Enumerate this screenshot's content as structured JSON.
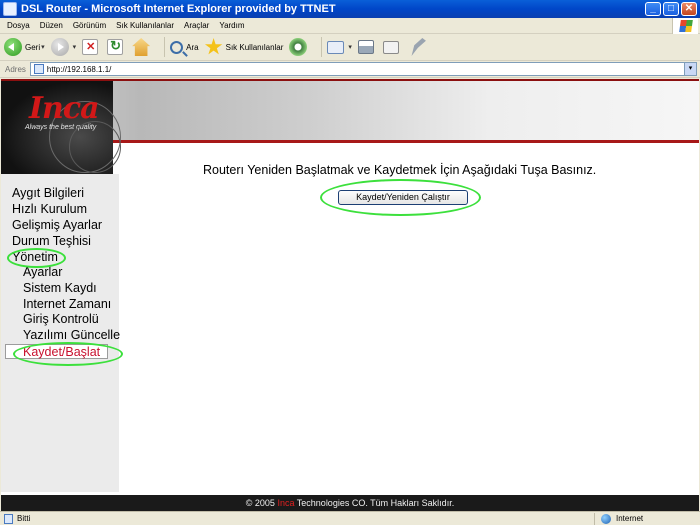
{
  "window": {
    "title": "DSL Router - Microsoft Internet Explorer provided by TTNET",
    "buttons": {
      "minimize": "_",
      "maximize": "□",
      "close": "✕"
    }
  },
  "menu": [
    "Dosya",
    "Düzen",
    "Görünüm",
    "Sık Kullanılanlar",
    "Araçlar",
    "Yardım"
  ],
  "toolbar": {
    "back_label": "Geri",
    "search_label": "Ara",
    "favorites_label": "Sık Kullanılanlar",
    "caret": "▾"
  },
  "address": {
    "label": "Adres",
    "url": "http://192.168.1.1/",
    "dropdown": "▾"
  },
  "banner": {
    "logo": "Inca",
    "slogan": "Always the best quality"
  },
  "sidebar": {
    "items": [
      "Aygıt Bilgileri",
      "Hızlı Kurulum",
      "Gelişmiş Ayarlar",
      "Durum Teşhisi",
      "Yönetim"
    ],
    "subitems": [
      "Ayarlar",
      "Sistem Kaydı",
      "Internet Zamanı",
      "Giriş Kontrolü",
      "Yazılımı Güncelle",
      "Kaydet/Başlat"
    ],
    "active": "Kaydet/Başlat"
  },
  "main": {
    "message": "Routerı Yeniden Başlatmak ve Kaydetmek İçin Aşağıdaki Tuşa Basınız.",
    "button_label": "Kaydet/Yeniden Çalıştır"
  },
  "footer": {
    "prefix": "© 2005 ",
    "brand": "Inca",
    "suffix": " Technologies CO. Tüm Hakları Saklıdır."
  },
  "status": {
    "text": "Bitti",
    "zone": "Internet"
  },
  "colors": {
    "accent_red": "#c8102e",
    "highlight_green": "#3ce03c",
    "titlebar_blue": "#0046c8"
  }
}
